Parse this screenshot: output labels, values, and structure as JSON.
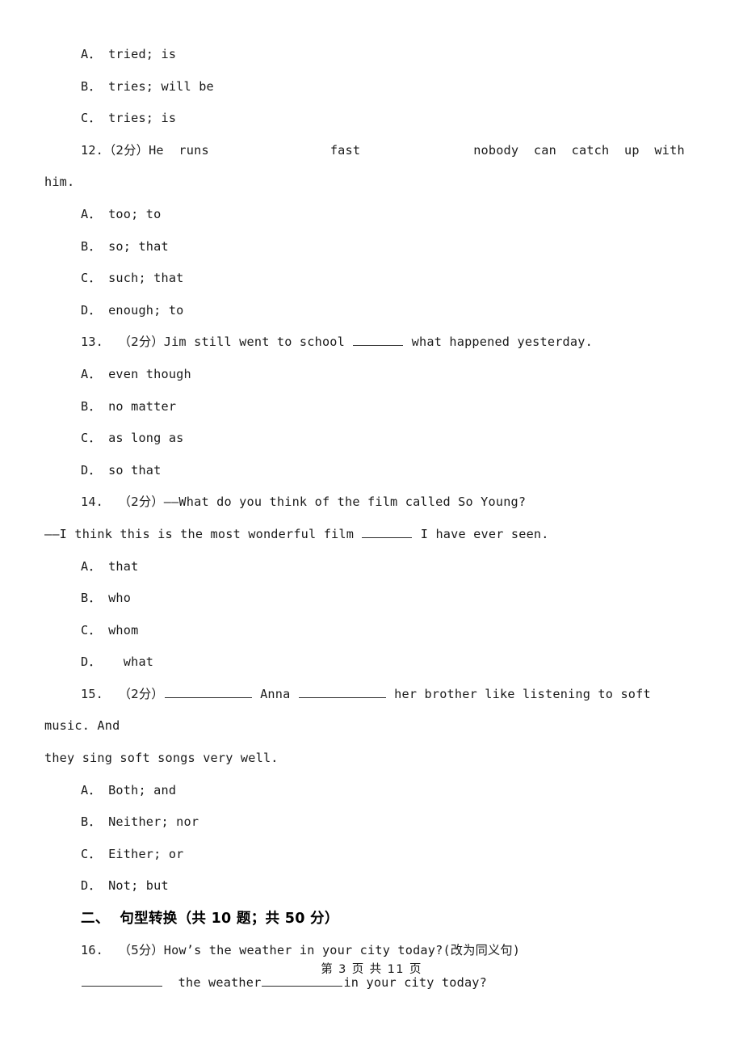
{
  "document": {
    "type": "exam-worksheet",
    "language": "zh-CN/en",
    "text_color": "#1a1a1a",
    "background": "#ffffff"
  },
  "blocks": {
    "q11_options": [
      "A． tried; is",
      "B． tries; will be",
      "C． tries; is"
    ],
    "q12": {
      "number": "12.",
      "score": "（2分）",
      "stem_part1": "He  runs",
      "stem_part2": "fast",
      "stem_part3": "nobody  can  catch  up  with",
      "stem_cont": "him.",
      "options": [
        "A． too; to",
        "B． so; that",
        "C． such; that",
        "D． enough; to"
      ]
    },
    "q13": {
      "number": "13.",
      "score": "（2分）",
      "stem_before": "Jim still went to school ",
      "stem_after": " what happened yesterday.",
      "options": [
        "A． even though",
        "B． no matter",
        "C． as long as",
        "D． so that"
      ]
    },
    "q14": {
      "number": "14.",
      "score": "（2分）",
      "stem_line1": "——What do you think of the film called So Young?",
      "stem_line2_before": "——I think this is the most wonderful film ",
      "stem_line2_after": " I have ever seen.",
      "options": [
        "A． that",
        "B． who",
        "C． whom",
        "D．   what"
      ]
    },
    "q15": {
      "number": "15.",
      "score": "（2分）",
      "stem_mid": " Anna ",
      "stem_after": " her brother like listening to soft music. And",
      "stem_cont": "they sing soft songs very well.",
      "options": [
        "A． Both; and",
        "B． Neither; nor",
        "C． Either; or",
        "D． Not; but"
      ]
    },
    "section2": {
      "heading": "二、  句型转换（共 10 题；共 50 分）"
    },
    "q16": {
      "number": "16.",
      "score": "（5分）",
      "stem": "How’s the weather in your city today?(改为同义句)",
      "answer_mid": "  the weather",
      "answer_after": "in your city today?"
    }
  },
  "footer": {
    "page_label": "第 3 页 共 11 页"
  }
}
